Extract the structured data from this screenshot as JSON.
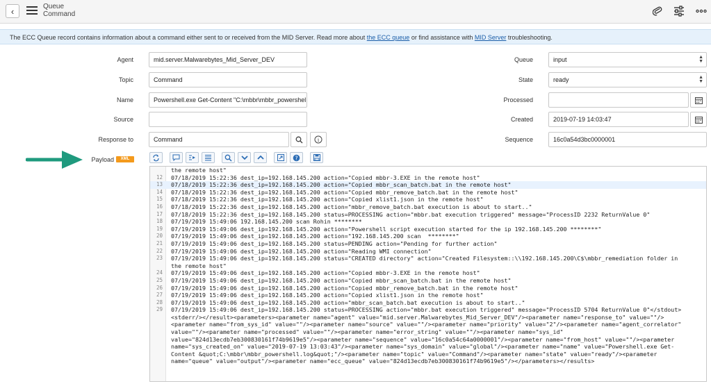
{
  "header": {
    "title_line1": "Queue",
    "title_line2": "Command",
    "back_label": "‹"
  },
  "banner": {
    "text_before": "The ECC Queue record contains information about a command either sent to or received from the MID Server. Read more about ",
    "link1": "the ECC queue",
    "text_middle": " or find assistance with ",
    "link2": "MID Server",
    "text_after": " troubleshooting."
  },
  "form": {
    "agent_label": "Agent",
    "agent_value": "mid.server.Malwarebytes_Mid_Server_DEV",
    "topic_label": "Topic",
    "topic_value": "Command",
    "name_label": "Name",
    "name_value": "Powershell.exe Get-Content \"C:\\mbbr\\mbbr_powershel",
    "source_label": "Source",
    "source_value": "",
    "response_label": "Response to",
    "response_value": "Command",
    "payload_label": "Payload",
    "xml_badge": "XML",
    "queue_label": "Queue",
    "queue_value": "input",
    "state_label": "State",
    "state_value": "ready",
    "processed_label": "Processed",
    "processed_value": "",
    "created_label": "Created",
    "created_value": "2019-07-19 14:03:47",
    "sequence_label": "Sequence",
    "sequence_value": "16c0a54d3bc0000001"
  },
  "editor": {
    "lines": [
      {
        "num": "",
        "text": "the remote host\""
      },
      {
        "num": "12",
        "text": "07/18/2019 15:22:36 dest_ip=192.168.145.200 action=\"Copied mbbr-3.EXE in the remote host\""
      },
      {
        "num": "13",
        "text": "07/18/2019 15:22:36 dest_ip=192.168.145.200 action=\"Copied mbbr_scan_batch.bat in the remote host\""
      },
      {
        "num": "14",
        "text": "07/18/2019 15:22:36 dest_ip=192.168.145.200 action=\"Copied mbbr_remove_batch.bat in the remote host\""
      },
      {
        "num": "15",
        "text": "07/18/2019 15:22:36 dest_ip=192.168.145.200 action=\"Copied xlist1.json in the remote host\""
      },
      {
        "num": "16",
        "text": "07/18/2019 15:22:36 dest_ip=192.168.145.200 action=\"mbbr_remove_batch.bat execution is about to start..\""
      },
      {
        "num": "17",
        "text": "07/18/2019 15:22:36 dest_ip=192.168.145.200 status=PROCESSING action=\"mbbr.bat execution triggered\" message=\"ProcessID 2232 ReturnValue 0\""
      },
      {
        "num": "18",
        "text": "07/19/2019 15:49:06 192.168.145.200 scan Rohin ********"
      },
      {
        "num": "19",
        "text": "07/19/2019 15:49:06 dest_ip=192.168.145.200 action=\"Powershell script execution started for the ip 192.168.145.200 ********\""
      },
      {
        "num": "20",
        "text": "07/19/2019 15:49:06 dest_ip=192.168.145.200 action=\"192.168.145.200 scan  ********\""
      },
      {
        "num": "21",
        "text": "07/19/2019 15:49:06 dest_ip=192.168.145.200 status=PENDING action=\"Pending for further action\""
      },
      {
        "num": "22",
        "text": "07/19/2019 15:49:06 dest_ip=192.168.145.200 action=\"Reading WMI connection\""
      },
      {
        "num": "23",
        "text": "07/19/2019 15:49:06 dest_ip=192.168.145.200 status=\"CREATED directory\" action=\"Created Filesystem::\\\\192.168.145.200\\C$\\mbbr_remediation folder in"
      },
      {
        "num": "",
        "text": "the remote host\""
      },
      {
        "num": "24",
        "text": "07/19/2019 15:49:06 dest_ip=192.168.145.200 action=\"Copied mbbr-3.EXE in the remote host\""
      },
      {
        "num": "25",
        "text": "07/19/2019 15:49:06 dest_ip=192.168.145.200 action=\"Copied mbbr_scan_batch.bat in the remote host\""
      },
      {
        "num": "26",
        "text": "07/19/2019 15:49:06 dest_ip=192.168.145.200 action=\"Copied mbbr_remove_batch.bat in the remote host\""
      },
      {
        "num": "27",
        "text": "07/19/2019 15:49:06 dest_ip=192.168.145.200 action=\"Copied xlist1.json in the remote host\""
      },
      {
        "num": "28",
        "text": "07/19/2019 15:49:06 dest_ip=192.168.145.200 action=\"mbbr_scan_batch.bat execution is about to start..\""
      },
      {
        "num": "29",
        "text": "07/19/2019 15:49:06 dest_ip=192.168.145.200 status=PROCESSING action=\"mbbr.bat execution triggered\" message=\"ProcessID 5704 ReturnValue 0\"</stdout>"
      }
    ],
    "xml_lines": [
      "<stderr/></result><parameters><parameter name=\"agent\" value=\"mid.server.Malwarebytes_Mid_Server_DEV\"/><parameter name=\"response_to\" value=\"\"/>",
      "<parameter name=\"from_sys_id\" value=\"\"/><parameter name=\"source\" value=\"\"/><parameter name=\"priority\" value=\"2\"/><parameter name=\"agent_correlator\"",
      "value=\"\"/><parameter name=\"processed\" value=\"\"/><parameter name=\"error_string\" value=\"\"/><parameter name=\"sys_id\"",
      "value=\"824d13ecdb7eb300830161f74b9619e5\"/><parameter name=\"sequence\" value=\"16c0a54c64a0000001\"/><parameter name=\"from_host\" value=\"\"/><parameter",
      "name=\"sys_created_on\" value=\"2019-07-19 13:03:43\"/><parameter name=\"sys_domain\" value=\"global\"/><parameter name=\"name\" value=\"Powershell.exe Get-",
      "Content &quot;C:\\mbbr\\mbbr_powershell.log&quot;\"/><parameter name=\"topic\" value=\"Command\"/><parameter name=\"state\" value=\"ready\"/><parameter",
      "name=\"queue\" value=\"output\"/><parameter name=\"ecc_queue\" value=\"824d13ecdb7eb300830161f74b9619e5\"/></parameters></results>"
    ]
  }
}
